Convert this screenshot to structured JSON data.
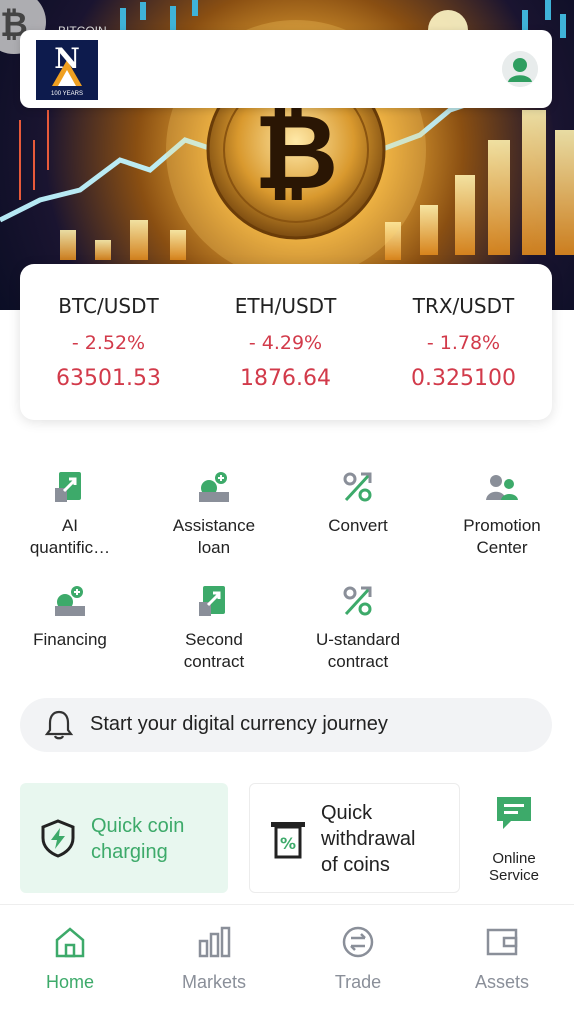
{
  "header": {
    "logo_letter": "N",
    "logo_subtext": "100 YEARS"
  },
  "banner": {
    "caption": "BITCOIN"
  },
  "tickers": [
    {
      "pair": "BTC/USDT",
      "change": "- 2.52%",
      "price": "63501.53"
    },
    {
      "pair": "ETH/USDT",
      "change": "- 4.29%",
      "price": "1876.64"
    },
    {
      "pair": "TRX/USDT",
      "change": "- 1.78%",
      "price": "0.325100"
    }
  ],
  "features": [
    {
      "label_line1": "AI",
      "label_line2": "quantific…",
      "icon": "chart-doc-icon"
    },
    {
      "label_line1": "Assistance",
      "label_line2": "loan",
      "icon": "loan-icon"
    },
    {
      "label_line1": "Convert",
      "label_line2": "",
      "icon": "percent-arrow-icon"
    },
    {
      "label_line1": "Promotion",
      "label_line2": "Center",
      "icon": "users-icon"
    },
    {
      "label_line1": "Financing",
      "label_line2": "",
      "icon": "financing-icon"
    },
    {
      "label_line1": "Second",
      "label_line2": "contract",
      "icon": "chart-doc-icon"
    },
    {
      "label_line1": "U-standard",
      "label_line2": "contract",
      "icon": "percent-arrow-icon"
    }
  ],
  "notice": {
    "text": "Start your digital currency journey"
  },
  "quick_actions": {
    "charge_line1": "Quick coin",
    "charge_line2": "charging",
    "withdraw_line1": "Quick",
    "withdraw_line2": "withdrawal",
    "withdraw_line3": "of coins",
    "online_line1": "Online",
    "online_line2": "Service"
  },
  "nav": [
    {
      "label": "Home",
      "active": true
    },
    {
      "label": "Markets",
      "active": false
    },
    {
      "label": "Trade",
      "active": false
    },
    {
      "label": "Assets",
      "active": false
    }
  ],
  "colors": {
    "accent_green": "#3daa6a",
    "negative_red": "#d23a4a",
    "icon_gray": "#8a8f99"
  }
}
